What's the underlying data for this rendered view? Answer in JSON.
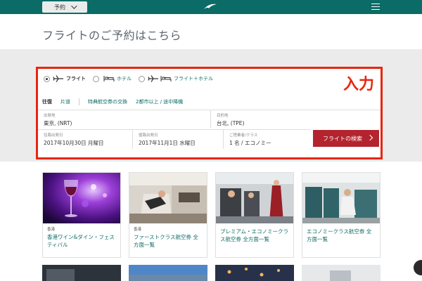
{
  "header": {
    "reserve_label": "予約",
    "colors": {
      "bar": "#0b6b66"
    }
  },
  "page_title": "フライトのご予約はこちら",
  "booking": {
    "options": [
      {
        "label": "フライト",
        "selected": true
      },
      {
        "label": "ホテル",
        "selected": false
      },
      {
        "label": "フライト＋ホテル",
        "selected": false
      }
    ],
    "annotation": "入力",
    "tabs": [
      {
        "label": "往復",
        "active": true
      },
      {
        "label": "片道",
        "active": false
      },
      {
        "label": "特典航空券の交換",
        "active": false
      },
      {
        "label": "2都市以上 / 途中降機",
        "active": false
      }
    ],
    "origin": {
      "label": "出発地",
      "value": "東京, (NRT)"
    },
    "destination": {
      "label": "目的地",
      "value": "台北, (TPE)"
    },
    "depart": {
      "label": "往路出発日",
      "value": "2017年10月30日 月曜日"
    },
    "return": {
      "label": "復路出発日",
      "value": "2017年11月1日 水曜日"
    },
    "passengers": {
      "label": "ご搭乗者/クラス",
      "value": "1 名 / エコノミー"
    },
    "search_label": "フライトの検索",
    "colors": {
      "highlight": "#e8250f",
      "search": "#b3242e"
    }
  },
  "cards": [
    {
      "category": "香港",
      "title": "香港ワイン&ダイン・フェスティバル"
    },
    {
      "category": "香港",
      "title": "ファーストクラス航空券 全方面一覧"
    },
    {
      "category": "",
      "title": "プレミアム・エコノミークラス航空券 全方面一覧"
    },
    {
      "category": "",
      "title": "エコノミークラス航空券 全方面一覧"
    }
  ]
}
